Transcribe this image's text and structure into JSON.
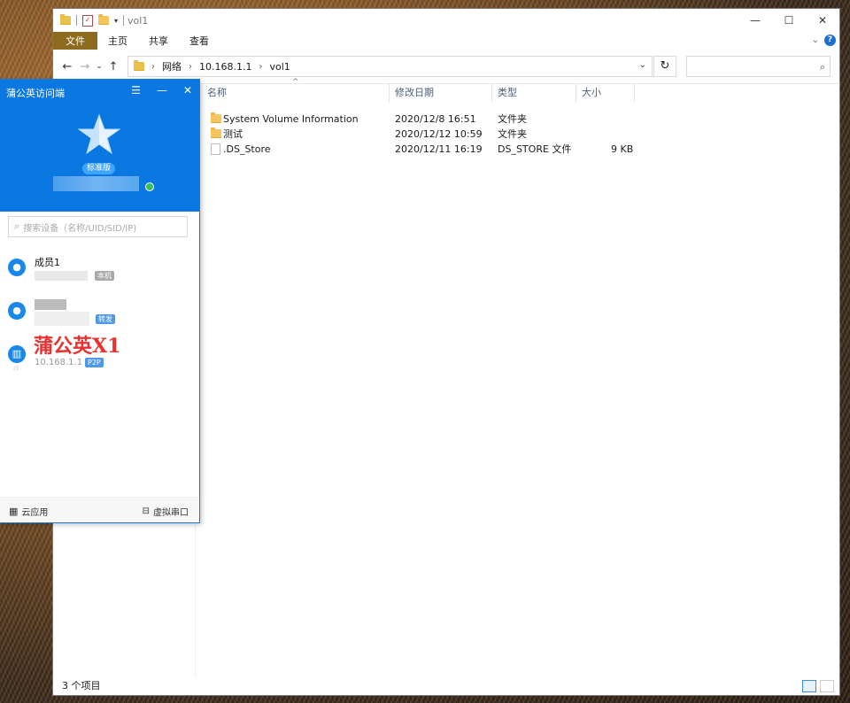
{
  "window": {
    "title": "vol1",
    "controls": {
      "minimize": "—",
      "maximize": "☐",
      "close": "✕"
    }
  },
  "ribbon": {
    "tabs": [
      "文件",
      "主页",
      "共享",
      "查看"
    ],
    "help": "?"
  },
  "address": {
    "crumbs": [
      "网络",
      "10.168.1.1",
      "vol1"
    ],
    "refresh": "↻",
    "search_placeholder": ""
  },
  "columns": {
    "name": "名称",
    "modified": "修改日期",
    "type": "类型",
    "size": "大小"
  },
  "files": [
    {
      "name": "System Volume Information",
      "modified": "2020/12/8 16:51",
      "type": "文件夹",
      "size": "",
      "icon": "folder-icon"
    },
    {
      "name": "测试",
      "modified": "2020/12/12 10:59",
      "type": "文件夹",
      "size": "",
      "icon": "folder-icon"
    },
    {
      "name": ".DS_Store",
      "modified": "2020/12/11 16:19",
      "type": "DS_STORE 文件",
      "size": "9 KB",
      "icon": "file-icon"
    }
  ],
  "status": {
    "count": "3 个项目"
  },
  "pgy": {
    "title": "蒲公英访问端",
    "edition_badge": "标准版",
    "search_placeholder": "搜索设备（名称/UID/SID/IP)",
    "members": [
      {
        "name": "成员1",
        "tag": "本机",
        "tag_style": "gray"
      },
      {
        "name": "",
        "tag": "转发",
        "tag_style": "blue"
      },
      {
        "name": "",
        "ip": "10.168.1.1",
        "tag": "P2P",
        "tag_style": "blue"
      }
    ],
    "overlay_text": "蒲公英X1",
    "footer": {
      "left": "云应用",
      "right": "虚拟串口"
    },
    "colors": {
      "header": "#0a78e0",
      "online": "#34c15b"
    }
  }
}
